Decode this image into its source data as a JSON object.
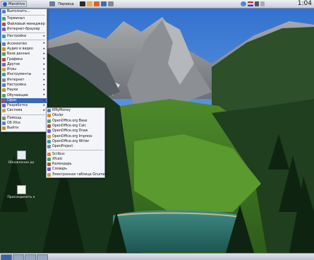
{
  "top_panel": {
    "menu_button": "Mandriva",
    "task_button": "Перевод",
    "clock": "1:04",
    "launchers": [
      "terminal-icon",
      "files-icon",
      "browser-icon",
      "mail-icon",
      "office-icon",
      "settings-icon"
    ],
    "tray": [
      "network-icon",
      "flag-icon",
      "volume-icon",
      "window-list-icon"
    ]
  },
  "main_menu": {
    "items": [
      {
        "label": "Выполнить...",
        "icon": "run-icon",
        "sub": false
      },
      {
        "sep": true
      },
      {
        "label": "Терминал",
        "icon": "terminal-icon",
        "sub": false
      },
      {
        "label": "Файловый менеджер",
        "icon": "folder-icon",
        "sub": false
      },
      {
        "label": "Интернет-браузер",
        "icon": "browser-icon",
        "sub": false
      },
      {
        "sep": true
      },
      {
        "label": "Настройки",
        "icon": "settings-icon",
        "sub": true
      },
      {
        "sep": true
      },
      {
        "label": "Accessories",
        "icon": "accessories-icon",
        "sub": true
      },
      {
        "label": "Аудио и видео",
        "icon": "multimedia-icon",
        "sub": true
      },
      {
        "label": "База данных",
        "icon": "database-icon",
        "sub": true
      },
      {
        "label": "Графика",
        "icon": "graphics-icon",
        "sub": true
      },
      {
        "label": "Другое",
        "icon": "other-icon",
        "sub": true
      },
      {
        "label": "Игры",
        "icon": "games-icon",
        "sub": true
      },
      {
        "label": "Инструменты",
        "icon": "tools-icon",
        "sub": true
      },
      {
        "label": "Интернет",
        "icon": "internet-icon",
        "sub": true
      },
      {
        "label": "Настройка",
        "icon": "config-icon",
        "sub": true
      },
      {
        "label": "Науки",
        "icon": "science-icon",
        "sub": true
      },
      {
        "label": "Обучающие",
        "icon": "education-icon",
        "sub": true
      },
      {
        "label": "Офис",
        "icon": "office-icon",
        "sub": true,
        "selected": true
      },
      {
        "label": "Разработка",
        "icon": "development-icon",
        "sub": true
      },
      {
        "label": "Система",
        "icon": "system-icon",
        "sub": true
      },
      {
        "sep": true
      },
      {
        "label": "Помощь",
        "icon": "help-icon",
        "sub": false
      },
      {
        "label": "Об Xfce",
        "icon": "about-icon",
        "sub": false
      },
      {
        "label": "Выйти",
        "icon": "logout-icon",
        "sub": false
      }
    ]
  },
  "office_submenu": {
    "items": [
      {
        "label": "KMyMoney",
        "icon": "kmymoney-icon"
      },
      {
        "label": "Okular",
        "icon": "okular-icon"
      },
      {
        "label": "OpenOffice.org Base",
        "icon": "oo-base-icon"
      },
      {
        "label": "OpenOffice.org Calc",
        "icon": "oo-calc-icon"
      },
      {
        "label": "OpenOffice.org Draw",
        "icon": "oo-draw-icon"
      },
      {
        "label": "OpenOffice.org Impress",
        "icon": "oo-impress-icon"
      },
      {
        "label": "OpenOffice.org Writer",
        "icon": "oo-writer-icon"
      },
      {
        "label": "OpenProject",
        "icon": "openproject-icon"
      },
      {
        "sep": true
      },
      {
        "label": "Scribus",
        "icon": "scribus-icon"
      },
      {
        "label": "Xfcalc",
        "icon": "xfcalc-icon"
      },
      {
        "label": "Календарь",
        "icon": "calendar-icon"
      },
      {
        "label": "Словарь",
        "icon": "dictionary-icon"
      },
      {
        "label": "Электронная таблица Gnumeric",
        "icon": "gnumeric-icon"
      }
    ]
  },
  "desktop_icons": [
    {
      "label": "Обновление до"
    },
    {
      "label": "Присоединить к"
    }
  ],
  "colors": {
    "selection": "#3d68b8",
    "menu_bg": "#f4f5f8",
    "panel": "#c8ccd6"
  }
}
